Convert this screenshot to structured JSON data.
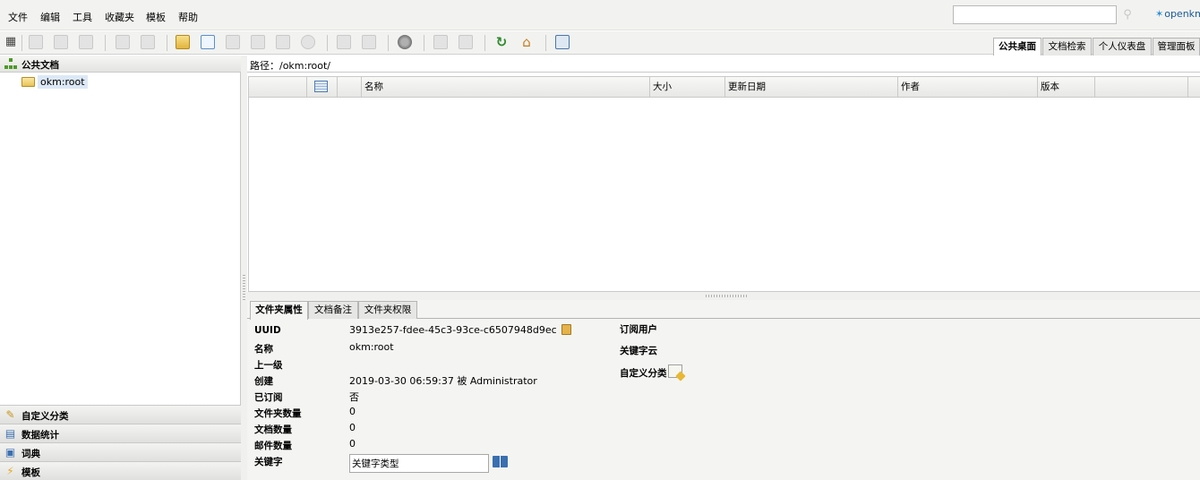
{
  "menu": [
    "文件",
    "编辑",
    "工具",
    "收藏夹",
    "模板",
    "帮助"
  ],
  "search": {
    "placeholder": ""
  },
  "brand": "openkm",
  "top_tabs": [
    "公共桌面",
    "文档检索",
    "个人仪表盘",
    "管理面板"
  ],
  "left": {
    "title": "公共文档",
    "tree_root": "okm:root",
    "panels": [
      "自定义分类",
      "数据统计",
      "词典",
      "模板"
    ]
  },
  "path": "路径：/okm:root/",
  "grid": {
    "columns": [
      "名称",
      "大小",
      "更新日期",
      "作者",
      "版本"
    ]
  },
  "props": {
    "tabs": [
      "文件夹属性",
      "文档备注",
      "文件夹权限"
    ],
    "rows": [
      {
        "label": "UUID",
        "value": "3913e257-fdee-45c3-93ce-c6507948d9ec"
      },
      {
        "label": "名称",
        "value": "okm:root"
      },
      {
        "label": "上一级",
        "value": ""
      },
      {
        "label": "创建",
        "value": "2019-03-30 06:59:37 被 Administrator"
      },
      {
        "label": "已订阅",
        "value": "否"
      },
      {
        "label": "文件夹数量",
        "value": "0"
      },
      {
        "label": "文档数量",
        "value": "0"
      },
      {
        "label": "邮件数量",
        "value": "0"
      },
      {
        "label": "关键字",
        "value": ""
      }
    ],
    "keyword_input_value": "关键字类型",
    "right_labels": [
      "订阅用户",
      "关键字云",
      "自定义分类"
    ]
  },
  "colors": {
    "selection": "#dce8f6",
    "panel_bg": "#f2f2f0",
    "border": "#c9c9c9"
  }
}
